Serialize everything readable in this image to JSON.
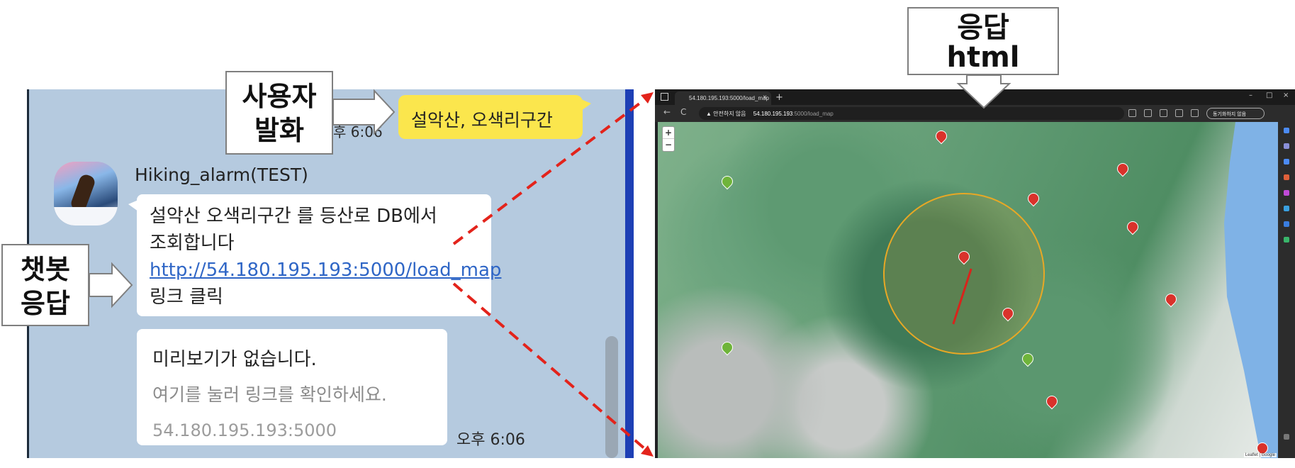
{
  "callouts": {
    "user_utterance": [
      "사용자",
      "발화"
    ],
    "bot_response": [
      "챗봇",
      "응답"
    ],
    "response_html": [
      "응답",
      "html"
    ]
  },
  "chat": {
    "user_message": "설악산, 오색리구간",
    "user_time": "후 6:06",
    "bot_name": "Hiking_alarm(TEST)",
    "bot_message_line1": "설악산 오색리구간 를 등산로 DB에서",
    "bot_message_line2": "조회합니다",
    "bot_link": "http://54.180.195.193:5000/load_map",
    "bot_message_line4": "링크 클릭",
    "preview_title": "미리보기가 없습니다.",
    "preview_hint": "여기를 눌러 링크를 확인하세요.",
    "preview_host": "54.180.195.193:5000",
    "bot_time": "오후 6:06"
  },
  "browser": {
    "tab_title": "54.180.195.193:5000/load_map",
    "tab_close": "×",
    "new_tab": "+",
    "security_warning": "▲ 안전하지 않음",
    "url_host": "54.180.195.193",
    "url_path": ":5000/load_map",
    "sync_button": "동기화하지 않음",
    "zoom_in": "+",
    "zoom_out": "−",
    "attribution": "Leaflet | Google",
    "window_minimize": "–",
    "window_maximize": "□",
    "window_close": "×",
    "nav_back": "←",
    "nav_reload": "C"
  },
  "colors": {
    "chat_bg": "#b5cadf",
    "user_bubble": "#fbe64d",
    "link": "#2f66c6",
    "arrow_dash": "#e3231b",
    "search_circle": "#e8a825",
    "trail": "#d8241c"
  }
}
